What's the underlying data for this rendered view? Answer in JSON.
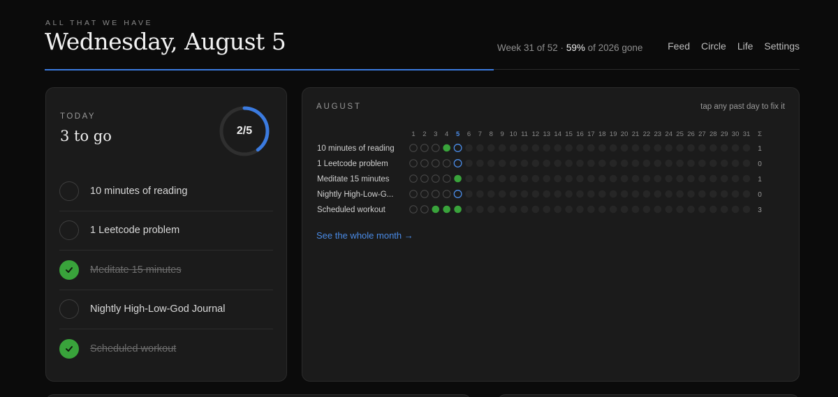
{
  "header": {
    "eyebrow": "ALL THAT WE HAVE",
    "title": "Wednesday, August 5",
    "week_prefix": "Week 31 of 52 · ",
    "year_pct": "59%",
    "week_suffix": " of 2026 gone",
    "year_progress": 0.59
  },
  "nav": [
    "Feed",
    "Circle",
    "Life",
    "Settings"
  ],
  "today": {
    "label": "TODAY",
    "remaining": "3 to go",
    "done": 2,
    "total": 5,
    "ring_label": "2/5",
    "habits": [
      {
        "name": "10 minutes of reading",
        "done": false
      },
      {
        "name": "1 Leetcode problem",
        "done": false
      },
      {
        "name": "Meditate 15 minutes",
        "done": true
      },
      {
        "name": "Nightly High-Low-God Journal",
        "done": true,
        "done_override": false
      },
      {
        "name": "Scheduled workout",
        "done": true
      }
    ]
  },
  "month": {
    "label": "AUGUST",
    "hint": "tap any past day to fix it",
    "days": 31,
    "today": 5,
    "sum_symbol": "Σ",
    "rows": [
      {
        "name": "10 minutes of reading",
        "done": [
          4
        ],
        "total": "1"
      },
      {
        "name": "1 Leetcode problem",
        "done": [],
        "total": "0"
      },
      {
        "name": "Meditate 15 minutes",
        "done": [
          5
        ],
        "total": "1"
      },
      {
        "name": "Nightly High-Low-G...",
        "done": [],
        "total": "0"
      },
      {
        "name": "Scheduled workout",
        "done": [
          3,
          4,
          5
        ],
        "total": "3"
      }
    ],
    "link": "See the whole month →"
  },
  "colors": {
    "accent": "#3b7be0",
    "done": "#39a33b",
    "link": "#4a8be6"
  }
}
